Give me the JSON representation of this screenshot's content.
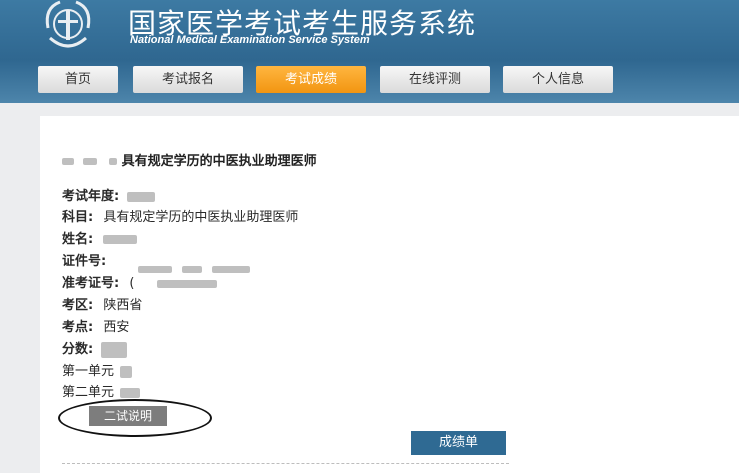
{
  "header": {
    "title_cn": "国家医学考试考生服务系统",
    "title_en": "National Medical Examination Service System"
  },
  "nav": {
    "tabs": [
      {
        "label": "首页",
        "active": false
      },
      {
        "label": "考试报名",
        "active": false
      },
      {
        "label": "考试成绩",
        "active": true
      },
      {
        "label": "在线评测",
        "active": false
      },
      {
        "label": "个人信息",
        "active": false
      }
    ]
  },
  "result": {
    "heading_visible": "具有规定学历的中医执业助理医师",
    "fields": {
      "year_label": "考试年度:",
      "subject_label": "科目:",
      "subject_value": "具有规定学历的中医执业助理医师",
      "name_label": "姓名:",
      "id_label": "证件号:",
      "ticket_label": "准考证号:",
      "ticket_value_visible": "(",
      "region_label": "考区:",
      "region_value": "陕西省",
      "site_label": "考点:",
      "site_value": "西安",
      "score_label": "分数:",
      "unit1_label": "第一单元",
      "unit2_label": "第二单元"
    },
    "second_exam_button": "二试说明",
    "score_sheet_button": "成绩单"
  },
  "colors": {
    "banner": "#3d7aa3",
    "active_tab": "#f29511",
    "primary_button": "#2f6a93"
  }
}
